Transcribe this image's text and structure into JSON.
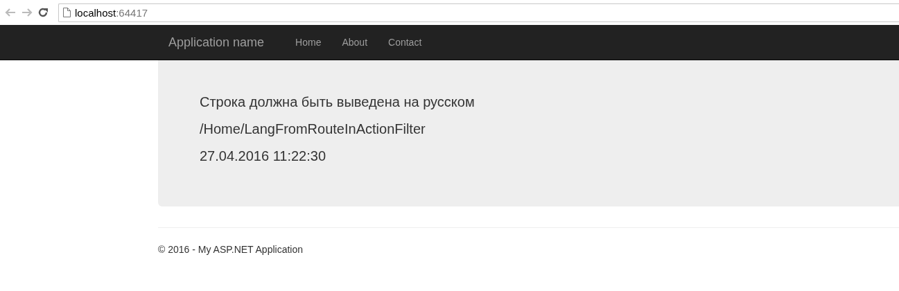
{
  "browser": {
    "url_host": "localhost",
    "url_port": ":64417"
  },
  "navbar": {
    "brand": "Application name",
    "links": [
      "Home",
      "About",
      "Contact"
    ]
  },
  "jumbotron": {
    "lines": [
      "Строка должна быть выведена на русском",
      "/Home/LangFromRouteInActionFilter",
      "27.04.2016 11:22:30"
    ]
  },
  "footer": {
    "text": "© 2016 - My ASP.NET Application"
  }
}
